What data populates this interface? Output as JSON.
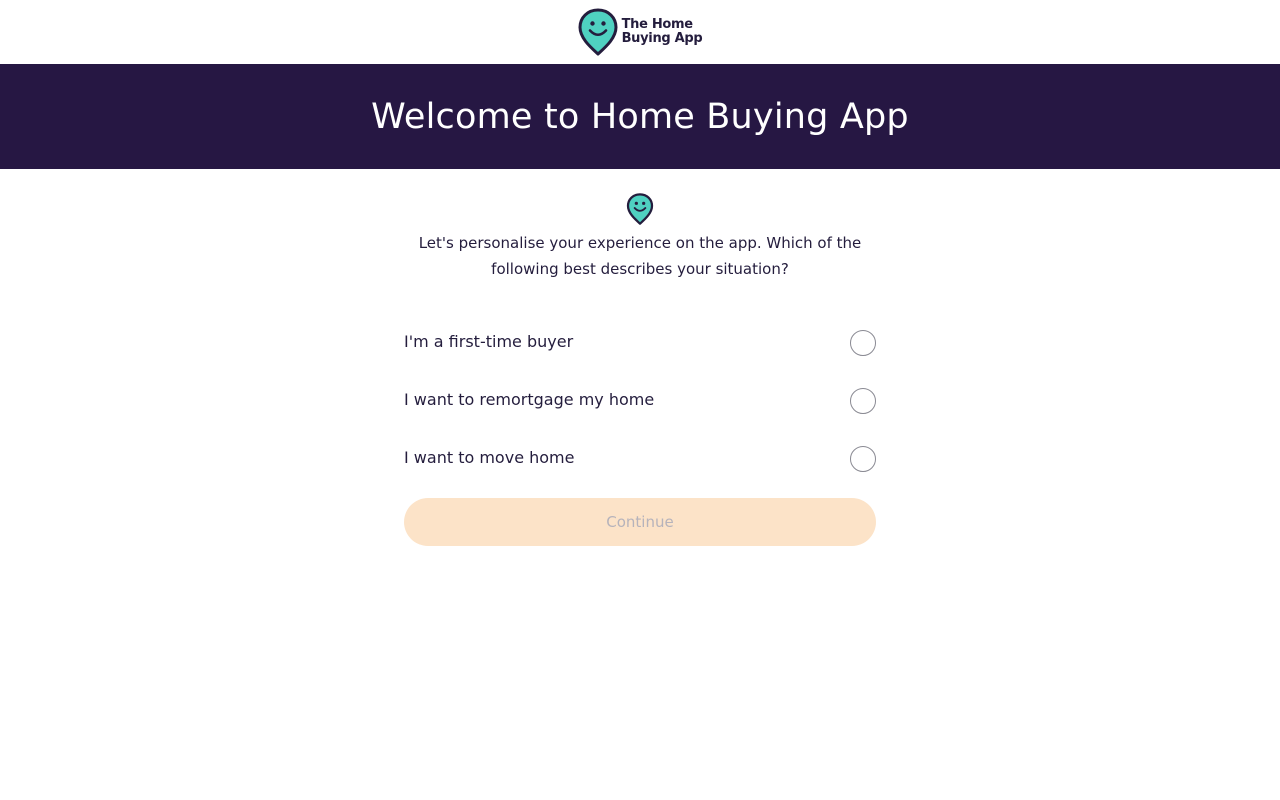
{
  "header": {
    "logo_line1": "The Home",
    "logo_line2": "Buying App",
    "logo_icon": "smiley-pin-icon"
  },
  "banner": {
    "title": "Welcome to Home Buying App"
  },
  "main": {
    "intro": "Let's personalise your experience on the app. Which of the following best describes your situation?",
    "options": [
      {
        "label": "I'm a first-time buyer",
        "selected": false
      },
      {
        "label": "I want to remortgage my home",
        "selected": false
      },
      {
        "label": "I want to move home",
        "selected": false
      }
    ],
    "continue_label": "Continue",
    "continue_disabled": true
  },
  "colors": {
    "brand_dark": "#261743",
    "brand_teal": "#4fd1c1",
    "continue_bg": "#fce3c8",
    "continue_text": "#b6b3bb",
    "text": "#241d3d"
  }
}
